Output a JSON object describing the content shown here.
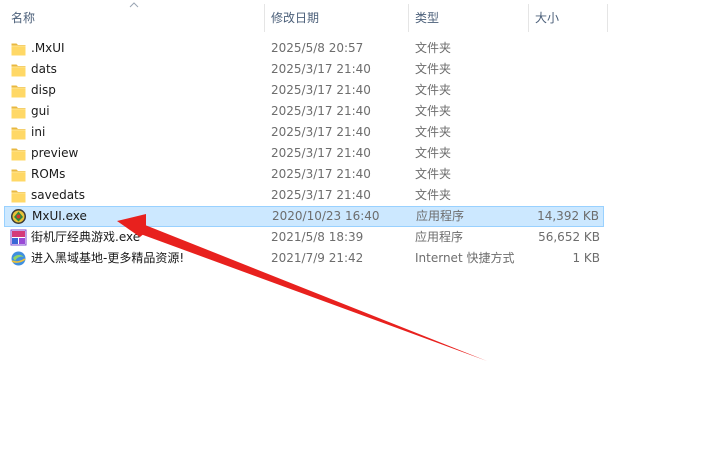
{
  "columns": {
    "name": "名称",
    "date": "修改日期",
    "type": "类型",
    "size": "大小"
  },
  "files": [
    {
      "name": ".MxUI",
      "date": "2025/5/8 20:57",
      "type": "文件夹",
      "size": "",
      "icon": "folder-icon",
      "selected": false
    },
    {
      "name": "dats",
      "date": "2025/3/17 21:40",
      "type": "文件夹",
      "size": "",
      "icon": "folder-icon",
      "selected": false
    },
    {
      "name": "disp",
      "date": "2025/3/17 21:40",
      "type": "文件夹",
      "size": "",
      "icon": "folder-icon",
      "selected": false
    },
    {
      "name": "gui",
      "date": "2025/3/17 21:40",
      "type": "文件夹",
      "size": "",
      "icon": "folder-icon",
      "selected": false
    },
    {
      "name": "ini",
      "date": "2025/3/17 21:40",
      "type": "文件夹",
      "size": "",
      "icon": "folder-icon",
      "selected": false
    },
    {
      "name": "preview",
      "date": "2025/3/17 21:40",
      "type": "文件夹",
      "size": "",
      "icon": "folder-icon",
      "selected": false
    },
    {
      "name": "ROMs",
      "date": "2025/3/17 21:40",
      "type": "文件夹",
      "size": "",
      "icon": "folder-icon",
      "selected": false
    },
    {
      "name": "savedats",
      "date": "2025/3/17 21:40",
      "type": "文件夹",
      "size": "",
      "icon": "folder-icon",
      "selected": false
    },
    {
      "name": "MxUI.exe",
      "date": "2020/10/23 16:40",
      "type": "应用程序",
      "size": "14,392 KB",
      "icon": "mxui-app-icon",
      "selected": true
    },
    {
      "name": "街机厅经典游戏.exe",
      "date": "2021/5/8 18:39",
      "type": "应用程序",
      "size": "56,652 KB",
      "icon": "arcade-app-icon",
      "selected": false
    },
    {
      "name": "进入黑域基地-更多精品资源!",
      "date": "2021/7/9 21:42",
      "type": "Internet 快捷方式",
      "size": "1 KB",
      "icon": "internet-shortcut-icon",
      "selected": false
    }
  ],
  "colors": {
    "selection_bg": "#cce8ff",
    "selection_border": "#99d1ff",
    "header_text": "#4c607a",
    "folder_yellow": "#ffd866",
    "annotation_arrow": "#e8211e"
  },
  "annotation": {
    "icon": "red-arrow-annotation",
    "points_to": "MxUI.exe"
  }
}
